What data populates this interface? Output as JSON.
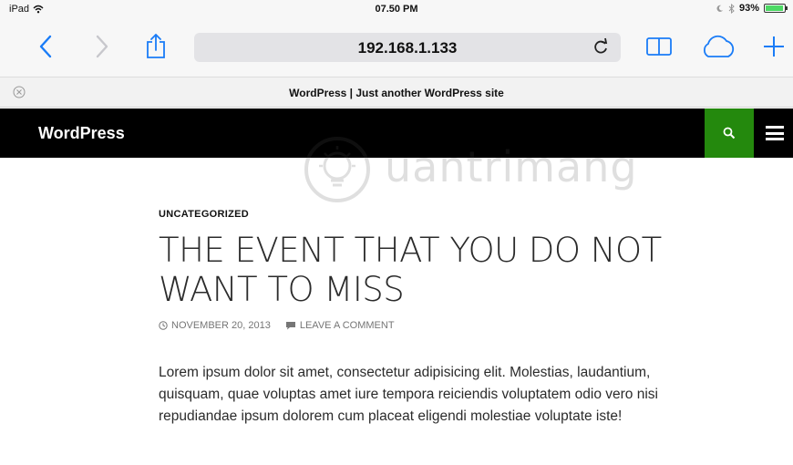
{
  "statusbar": {
    "device": "iPad",
    "time": "07.50 PM",
    "battery": "93%",
    "battery_level": 0.93
  },
  "toolbar": {
    "url": "192.168.1.133",
    "accent_color": "#1a7cf7"
  },
  "tab": {
    "title": "WordPress | Just another WordPress site"
  },
  "wp_header": {
    "site_title": "WordPress",
    "search_color": "#24890d"
  },
  "watermark": {
    "text": "uantrimang"
  },
  "article": {
    "category": "UNCATEGORIZED",
    "title": "THE EVENT THAT YOU DO NOT WANT TO MISS",
    "date": "NOVEMBER 20, 2013",
    "comment_link": "LEAVE A COMMENT",
    "excerpt": "Lorem ipsum dolor sit amet, consectetur adipisicing elit. Molestias, laudantium, quisquam, quae voluptas amet iure tempora reiciendis voluptatem odio vero nisi repudiandae ipsum dolorem cum placeat eligendi molestiae voluptate iste!"
  },
  "icons": {
    "back": "chevron-left-icon",
    "forward": "chevron-right-icon",
    "share": "share-icon",
    "reload": "reload-icon",
    "bookmarks": "book-icon",
    "cloud": "cloud-icon",
    "new_tab": "plus-icon",
    "close_tab": "close-icon",
    "search": "search-icon",
    "menu": "menu-icon",
    "clock": "clock-icon",
    "comment": "comment-icon"
  }
}
